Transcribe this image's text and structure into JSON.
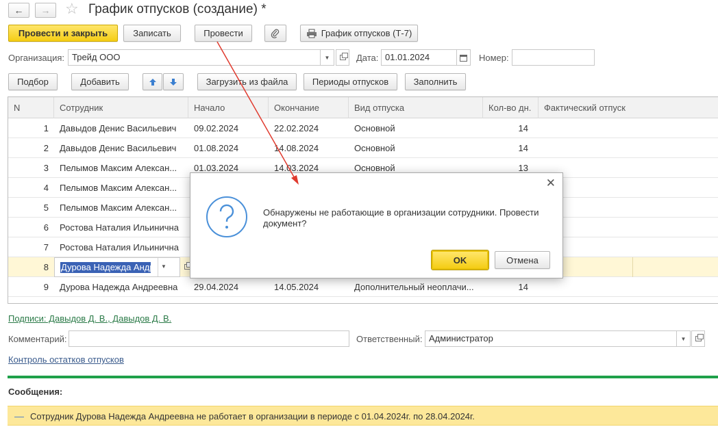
{
  "window": {
    "title": "График отпусков (создание) *"
  },
  "toolbar": {
    "post_close": "Провести и закрыть",
    "save": "Записать",
    "post": "Провести",
    "print": "График отпусков (Т-7)"
  },
  "header_fields": {
    "org_label": "Организация:",
    "org_value": "Трейд ООО",
    "date_label": "Дата:",
    "date_value": "01.01.2024",
    "number_label": "Номер:",
    "number_value": ""
  },
  "table_toolbar": {
    "pick": "Подбор",
    "add": "Добавить",
    "load_file": "Загрузить из файла",
    "periods": "Периоды отпусков",
    "fill": "Заполнить"
  },
  "table": {
    "columns": [
      "N",
      "Сотрудник",
      "Начало",
      "Окончание",
      "Вид отпуска",
      "Кол-во дн.",
      "Фактический отпуск"
    ],
    "rows": [
      {
        "n": "1",
        "employee": "Давыдов Денис Васильевич",
        "start": "09.02.2024",
        "end": "22.02.2024",
        "type": "Основной",
        "days": "14",
        "actual": ""
      },
      {
        "n": "2",
        "employee": "Давыдов Денис Васильевич",
        "start": "01.08.2024",
        "end": "14.08.2024",
        "type": "Основной",
        "days": "14",
        "actual": ""
      },
      {
        "n": "3",
        "employee": "Пелымов Максим Алексан...",
        "start": "01.03.2024",
        "end": "14.03.2024",
        "type": "Основной",
        "days": "13",
        "actual": ""
      },
      {
        "n": "4",
        "employee": "Пелымов Максим Алексан...",
        "start": "",
        "end": "",
        "type": "",
        "days": "",
        "actual": ""
      },
      {
        "n": "5",
        "employee": "Пелымов Максим Алексан...",
        "start": "",
        "end": "",
        "type": "",
        "days": "",
        "actual": ""
      },
      {
        "n": "6",
        "employee": "Ростова Наталия Ильинична",
        "start": "",
        "end": "",
        "type": "",
        "days": "",
        "actual": ""
      },
      {
        "n": "7",
        "employee": "Ростова Наталия Ильинична",
        "start": "",
        "end": "",
        "type": "",
        "days": "",
        "actual": ""
      },
      {
        "n": "8",
        "employee": "Дурова Надежда Андр",
        "start": "",
        "end": "",
        "type": "",
        "days": "",
        "actual": ""
      },
      {
        "n": "9",
        "employee": "Дурова Надежда Андреевна",
        "start": "29.04.2024",
        "end": "14.05.2024",
        "type": "Дополнительный неоплачи...",
        "days": "14",
        "actual": ""
      }
    ]
  },
  "footer": {
    "signatures_link": "Подписи: Давыдов Д. В., Давыдов Д. В.",
    "comment_label": "Комментарий:",
    "comment_value": "",
    "responsible_label": "Ответственный:",
    "responsible_value": "Администратор",
    "balance_link": "Контроль остатков отпусков"
  },
  "messages": {
    "title": "Сообщения:",
    "text": "Сотрудник Дурова Надежда Андреевна не работает в организации в периоде с 01.04.2024г. по 28.04.2024г."
  },
  "dialog": {
    "question_line1": "Обнаружены не работающие в организации сотрудники. Провести",
    "question_line2": "документ?",
    "ok": "OK",
    "cancel": "Отмена"
  },
  "colors": {
    "primary_button": "#f5cd15",
    "accent_green": "#1fa14a",
    "message_bar": "#fde89a",
    "selection": "#3a62b5",
    "annotation_arrow": "#e03a2e"
  }
}
